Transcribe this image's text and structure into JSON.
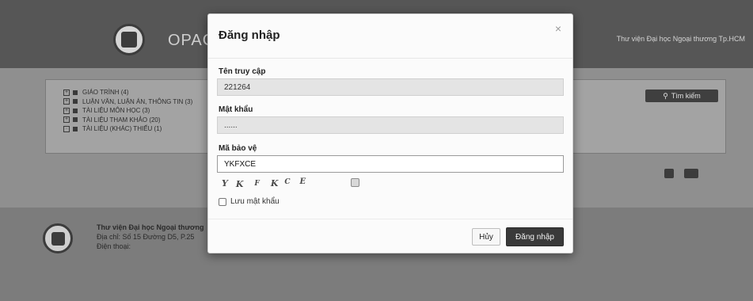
{
  "background": {
    "brand": "OPAC",
    "header_right": "Thư viện Đại học Ngoại thương Tp.HCM",
    "tree_items": [
      "GIÁO TRÌNH (4)",
      "LUẬN VĂN, LUẬN ÁN, THÔNG TIN (3)",
      "TÀI LIỆU MÔN HỌC (3)",
      "TÀI LIỆU THAM KHẢO (20)",
      "TÀI LIỆU (KHÁC) THIẾU (1)"
    ],
    "search_button": "Tìm kiếm",
    "footer": {
      "line1": "Thư viện Đại học Ngoại thương",
      "line2": "Địa chỉ: Số 15 Đường D5, P.25",
      "line3": "Điện thoại:"
    }
  },
  "modal": {
    "title": "Đăng nhập",
    "close_icon": "×",
    "username": {
      "label": "Tên truy cập",
      "value": "221264"
    },
    "password": {
      "label": "Mật khẩu",
      "value": "......"
    },
    "captcha": {
      "label": "Mã bảo vệ",
      "value": "YKFXCE",
      "image_chars": [
        "Y",
        "K",
        "F",
        "K",
        "C",
        "E"
      ]
    },
    "remember_label": "Lưu mật khẩu",
    "cancel_label": "Hủy",
    "login_label": "Đăng nhập"
  }
}
